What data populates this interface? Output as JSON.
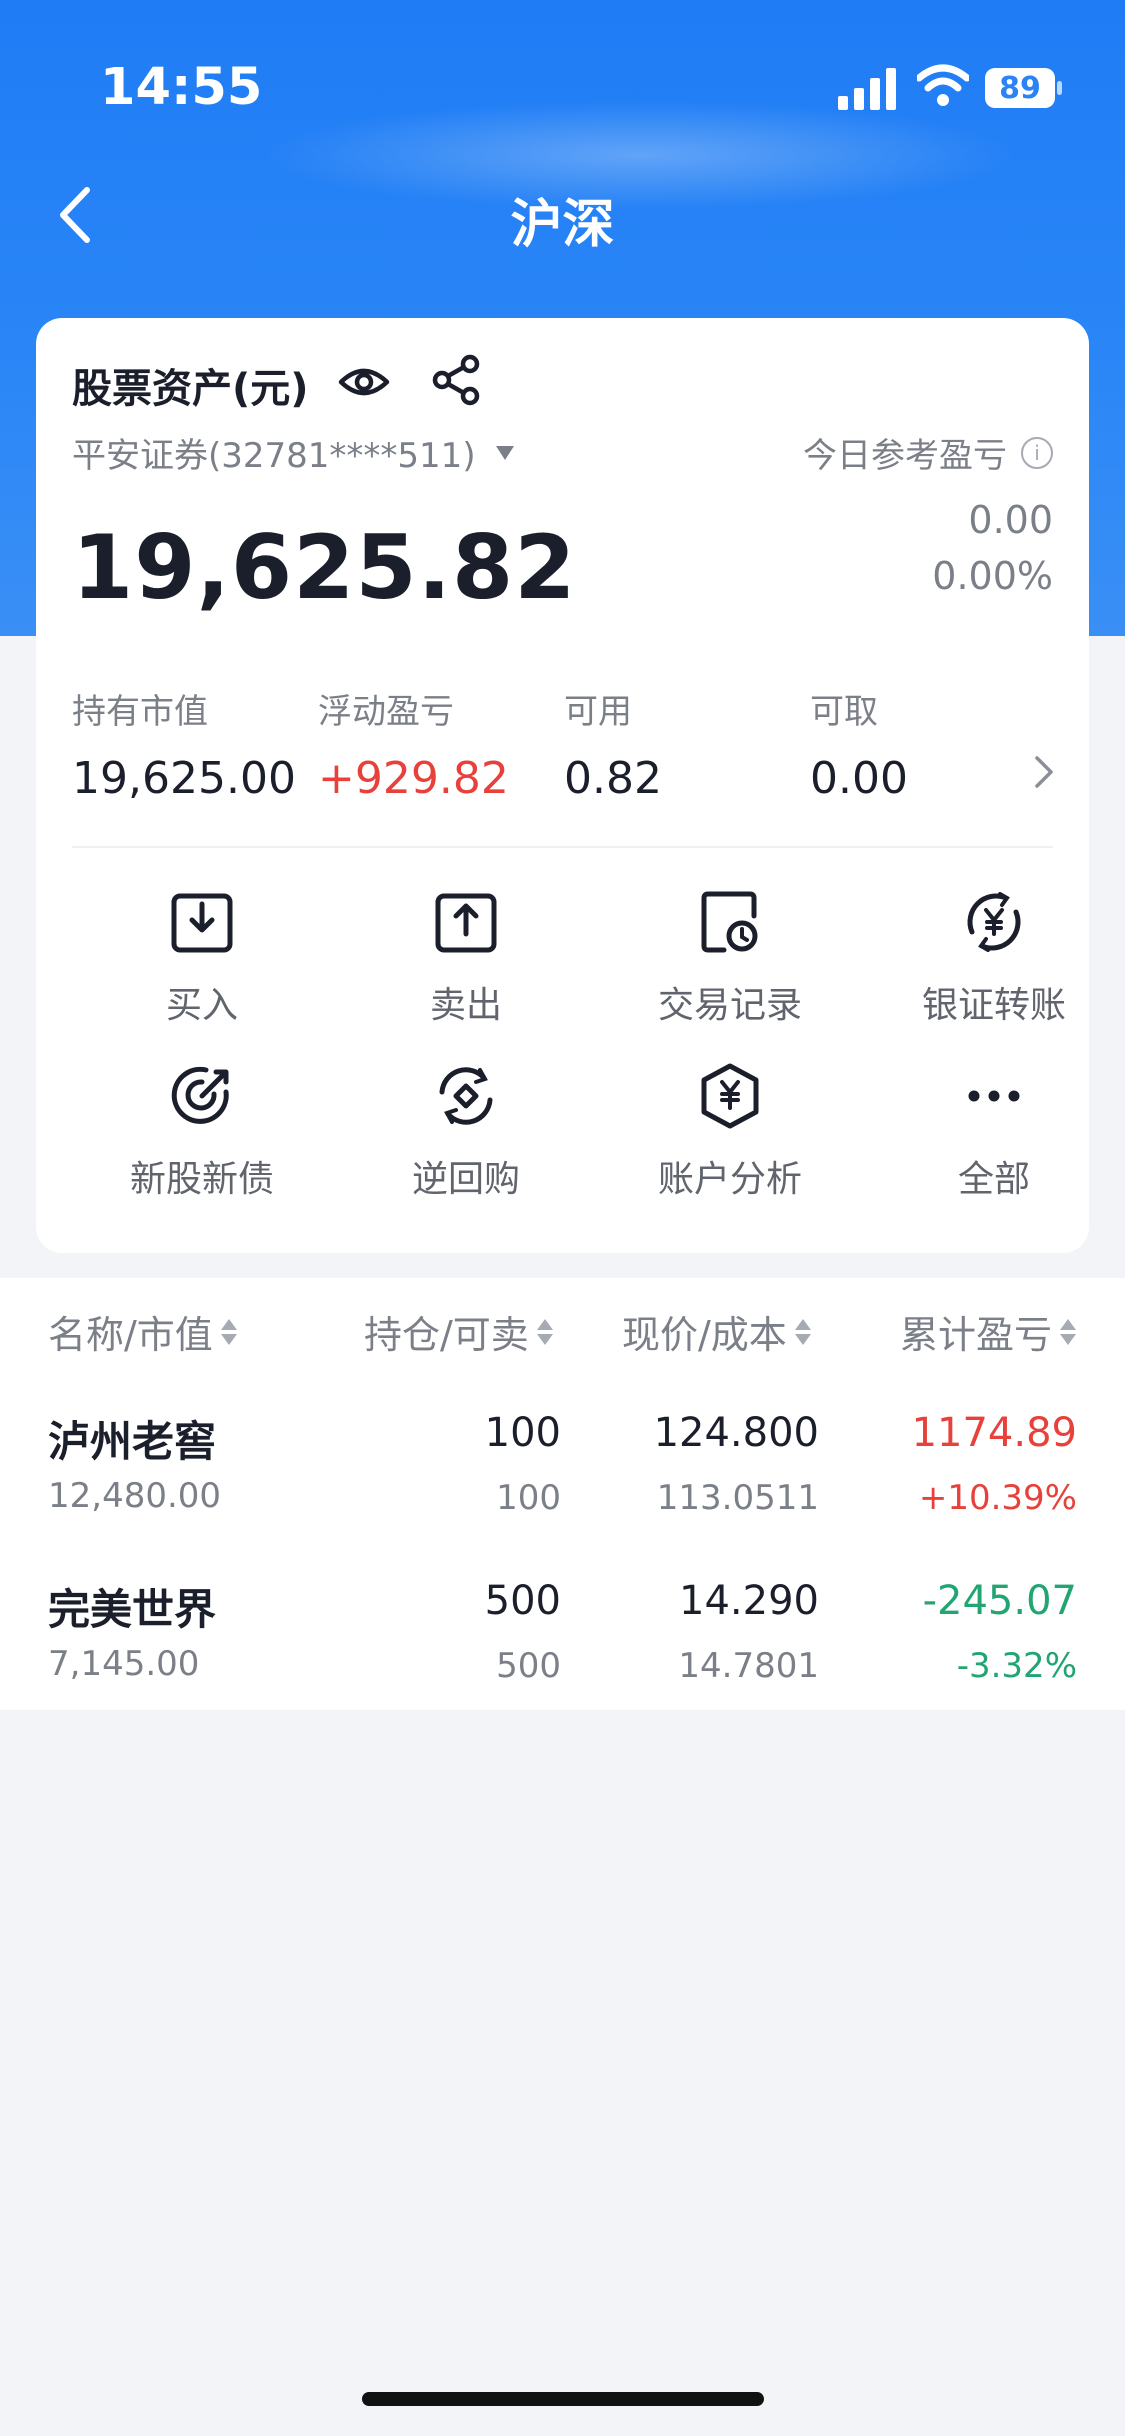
{
  "status_bar": {
    "time": "14:55",
    "battery": "89"
  },
  "nav": {
    "title": "沪深"
  },
  "asset_card": {
    "title": "股票资产(元)",
    "broker": "平安证券(32781****511)",
    "today_label": "今日参考盈亏",
    "total": "19,625.82",
    "today_value": "0.00",
    "today_pct": "0.00%",
    "stats": [
      {
        "label": "持有市值",
        "value": "19,625.00"
      },
      {
        "label": "浮动盈亏",
        "value": "+929.82"
      },
      {
        "label": "可用",
        "value": "0.82"
      },
      {
        "label": "可取",
        "value": "0.00"
      }
    ],
    "actions": [
      {
        "label": "买入",
        "icon": "buy-icon"
      },
      {
        "label": "卖出",
        "icon": "sell-icon"
      },
      {
        "label": "交易记录",
        "icon": "record-icon"
      },
      {
        "label": "银证转账",
        "icon": "transfer-icon"
      },
      {
        "label": "新股新债",
        "icon": "ipo-icon"
      },
      {
        "label": "逆回购",
        "icon": "repo-icon"
      },
      {
        "label": "账户分析",
        "icon": "analysis-icon"
      },
      {
        "label": "全部",
        "icon": "more-icon"
      }
    ]
  },
  "table": {
    "headers": [
      "名称/市值",
      "持仓/可卖",
      "现价/成本",
      "累计盈亏"
    ],
    "rows": [
      {
        "name": "泸州老窖",
        "market_value": "12,480.00",
        "holding": "100",
        "sellable": "100",
        "price": "124.800",
        "cost": "113.0511",
        "pnl": "1174.89",
        "pnl_pct": "+10.39%"
      },
      {
        "name": "完美世界",
        "market_value": "7,145.00",
        "holding": "500",
        "sellable": "500",
        "price": "14.290",
        "cost": "14.7801",
        "pnl": "-245.07",
        "pnl_pct": "-3.32%"
      }
    ]
  },
  "colors": {
    "accent": "#1f7cf5",
    "up": "#e8413b",
    "down": "#21a672",
    "badge": "#f7821b"
  }
}
